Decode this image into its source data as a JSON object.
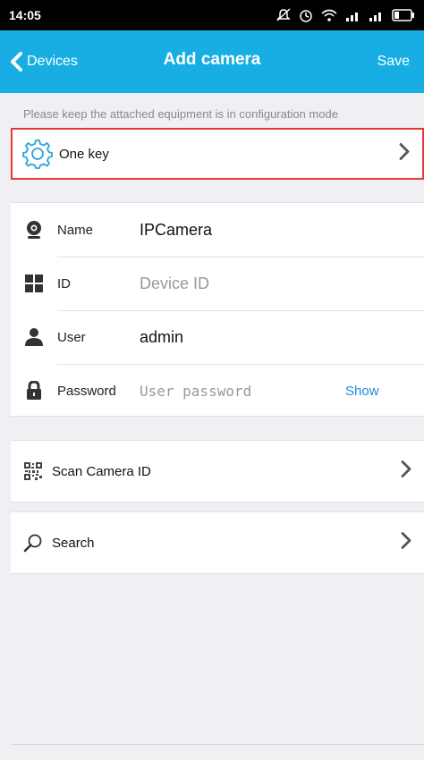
{
  "status_bar": {
    "time": "14:05"
  },
  "nav": {
    "back_label": "Devices",
    "title": "Add camera",
    "save_label": "Save"
  },
  "hint": "Please keep the attached equipment is in configuration mode",
  "one_key": {
    "label": "One key"
  },
  "form": {
    "name": {
      "label": "Name",
      "value": "IPCamera"
    },
    "id": {
      "label": "ID",
      "placeholder": "Device ID"
    },
    "user": {
      "label": "User",
      "value": "admin"
    },
    "password": {
      "label": "Password",
      "placeholder": "User password",
      "show_label": "Show"
    }
  },
  "scan": {
    "label": "Scan Camera ID"
  },
  "search": {
    "label": "Search"
  },
  "colors": {
    "nav_bg": "#18aee3",
    "highlight_border": "#e53935",
    "link": "#1a8fd8"
  }
}
